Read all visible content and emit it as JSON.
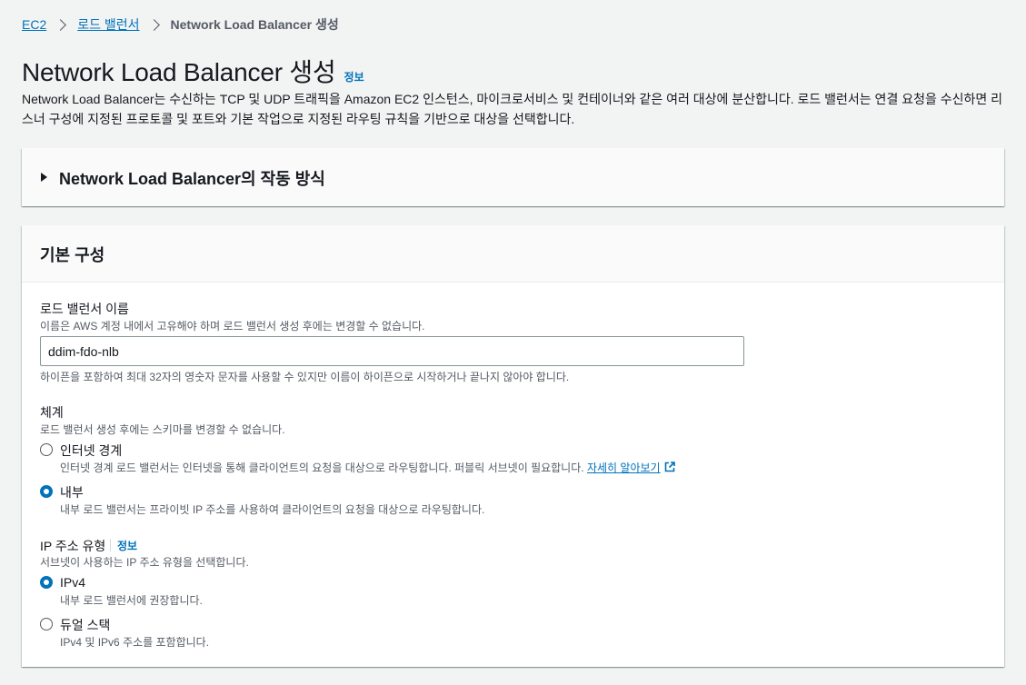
{
  "breadcrumb": {
    "items": [
      "EC2",
      "로드 밸런서"
    ],
    "current": "Network Load Balancer 생성"
  },
  "page": {
    "title": "Network Load Balancer 생성",
    "info_label": "정보",
    "description": "Network Load Balancer는 수신하는 TCP 및 UDP 트래픽을 Amazon EC2 인스턴스, 마이크로서비스 및 컨테이너와 같은 여러 대상에 분산합니다. 로드 밸런서는 연결 요청을 수신하면 리스너 구성에 지정된 프로토콜 및 포트와 기본 작업으로 지정된 라우팅 규칙을 기반으로 대상을 선택합니다."
  },
  "expander": {
    "label": "Network Load Balancer의 작동 방식"
  },
  "basic_config": {
    "title": "기본 구성",
    "name_field": {
      "label": "로드 밸런서 이름",
      "description": "이름은 AWS 계정 내에서 고유해야 하며 로드 밸런서 생성 후에는 변경할 수 없습니다.",
      "value": "ddim-fdo-nlb",
      "constraint": "하이픈을 포함하여 최대 32자의 영숫자 문자를 사용할 수 있지만 이름이 하이픈으로 시작하거나 끝나지 않아야 합니다."
    },
    "scheme": {
      "label": "체계",
      "description": "로드 밸런서 생성 후에는 스키마를 변경할 수 없습니다.",
      "options": [
        {
          "label": "인터넷 경계",
          "description": "인터넷 경계 로드 밸런서는 인터넷을 통해 클라이언트의 요청을 대상으로 라우팅합니다. 퍼블릭 서브넷이 필요합니다.",
          "link": "자세히 알아보기",
          "checked": false
        },
        {
          "label": "내부",
          "description": "내부 로드 밸런서는 프라이빗 IP 주소를 사용하여 클라이언트의 요청을 대상으로 라우팅합니다.",
          "checked": true
        }
      ]
    },
    "ip_type": {
      "label": "IP 주소 유형",
      "info_label": "정보",
      "description": "서브넷이 사용하는 IP 주소 유형을 선택합니다.",
      "options": [
        {
          "label": "IPv4",
          "description": "내부 로드 밸런서에 권장합니다.",
          "checked": true
        },
        {
          "label": "듀얼 스택",
          "description": "IPv4 및 IPv6 주소를 포함합니다.",
          "checked": false
        }
      ]
    }
  },
  "colors": {
    "accent": "#0073bb",
    "background": "#f2f3f3",
    "text": "#16191f",
    "muted": "#545b64"
  }
}
